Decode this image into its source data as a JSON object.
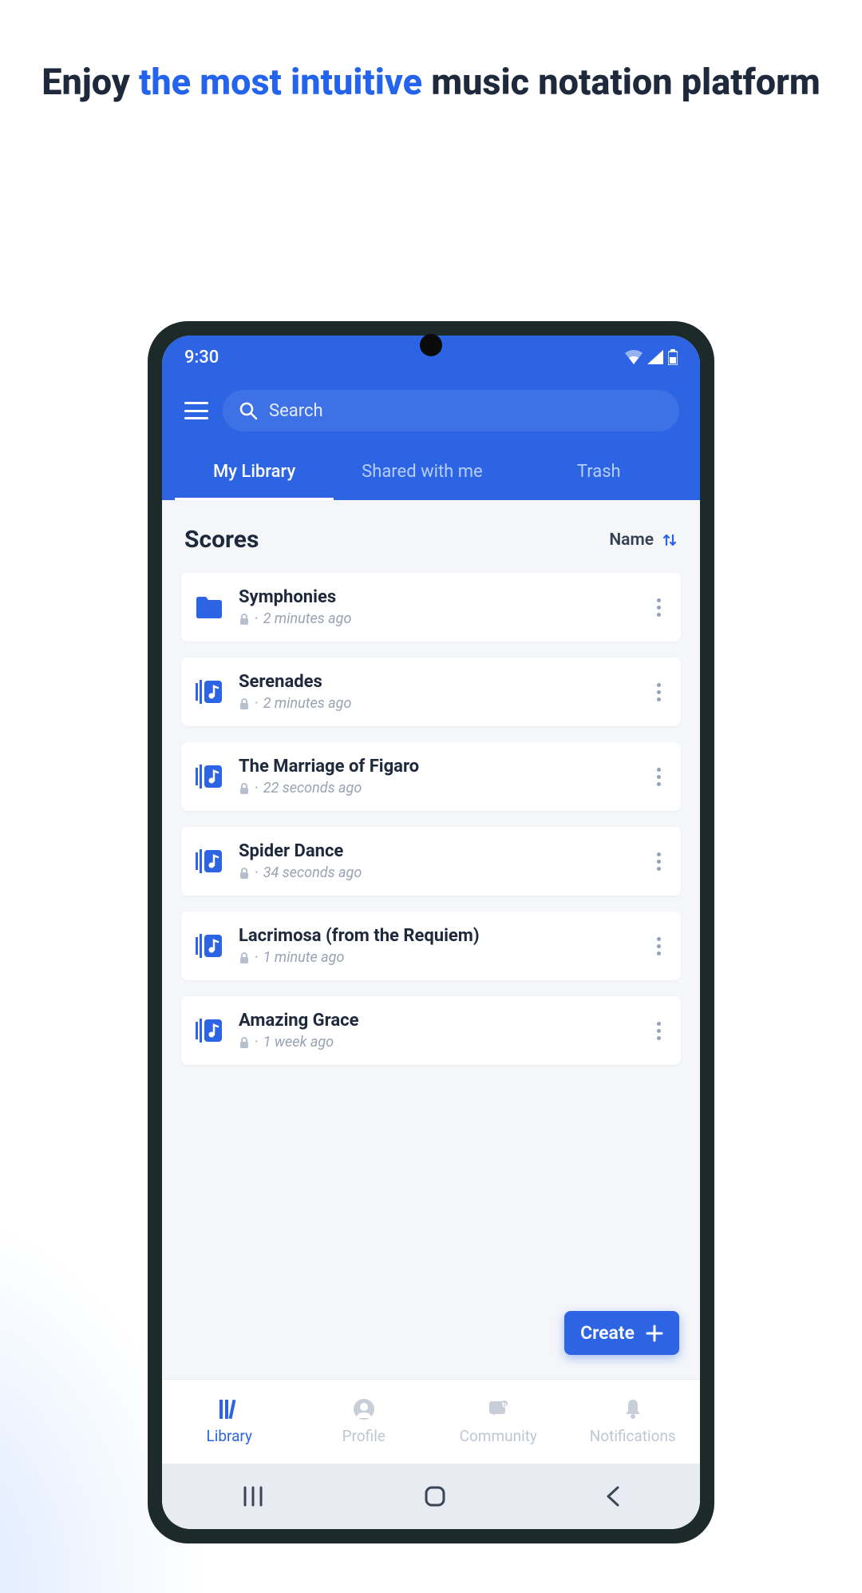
{
  "headline": {
    "part1": "Enjoy ",
    "accent": "the most intuitive",
    "part2": " music notation platform"
  },
  "status": {
    "time": "9:30"
  },
  "search": {
    "placeholder": "Search"
  },
  "tabs": [
    {
      "label": "My Library",
      "active": true
    },
    {
      "label": "Shared with me",
      "active": false
    },
    {
      "label": "Trash",
      "active": false
    }
  ],
  "section": {
    "title": "Scores"
  },
  "sort": {
    "label": "Name"
  },
  "items": [
    {
      "type": "folder",
      "title": "Symphonies",
      "time": "2 minutes ago"
    },
    {
      "type": "score",
      "title": "Serenades",
      "time": "2 minutes ago"
    },
    {
      "type": "score",
      "title": "The Marriage of Figaro",
      "time": "22 seconds ago"
    },
    {
      "type": "score",
      "title": "Spider Dance",
      "time": "34 seconds ago"
    },
    {
      "type": "score",
      "title": "Lacrimosa (from the Requiem)",
      "time": "1 minute ago"
    },
    {
      "type": "score",
      "title": "Amazing Grace",
      "time": "1 week ago"
    }
  ],
  "fab": {
    "label": "Create"
  },
  "bottomNav": [
    {
      "label": "Library",
      "active": true
    },
    {
      "label": "Profile",
      "active": false
    },
    {
      "label": "Community",
      "active": false
    },
    {
      "label": "Notifications",
      "active": false
    }
  ]
}
